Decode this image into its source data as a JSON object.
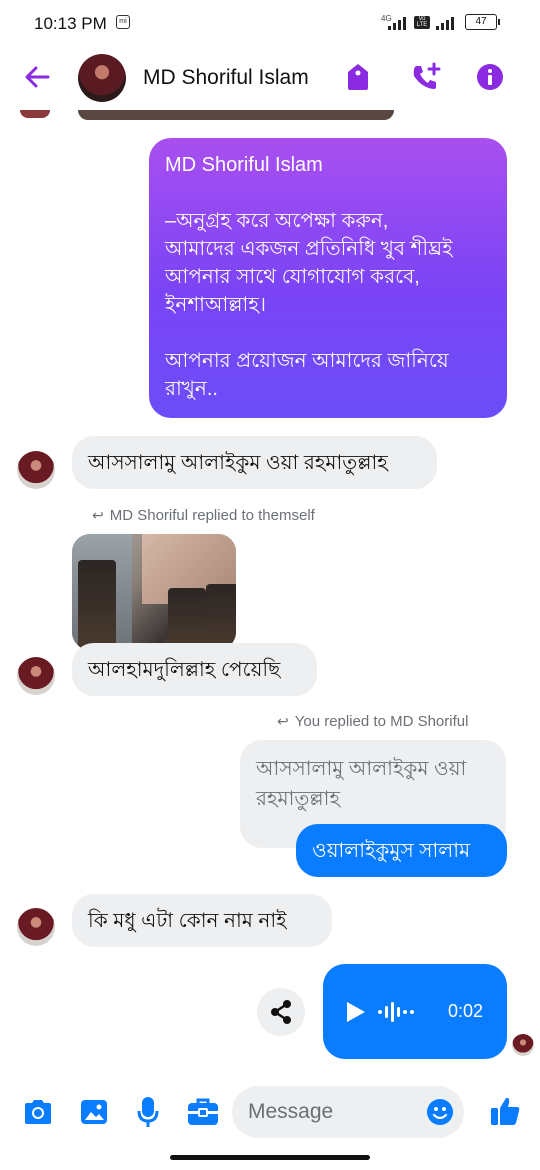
{
  "status_bar": {
    "time": "10:13 PM",
    "mi_label": "mi",
    "network": "4G",
    "volte": "Vo LTE",
    "battery": "47"
  },
  "header": {
    "contact_name": "MD Shoriful Islam",
    "accent_color": "#8a2be2",
    "icons": [
      "back-arrow-icon",
      "tag-icon",
      "add-call-icon",
      "info-icon"
    ]
  },
  "messages": {
    "auto_reply": {
      "title": "MD Shoriful Islam",
      "line1": "–অনুগ্রহ করে অপেক্ষা করুন,",
      "line2": "আমাদের একজন প্রতিনিধি খুব শীঘ্রই",
      "line3": "আপনার সাথে যোগাযোগ করবে,",
      "line4": "ইনশাআল্লাহ।",
      "line5": "আপনার প্রয়োজন আমাদের জানিয়ে",
      "line6": "রাখুন.."
    },
    "greeting": "আসসালামু আলাইকুম ওয়া রহমাতুল্লাহ",
    "reply_meta_1": "MD Shoriful replied to themself",
    "alhamdulillah": "আলহামদুলিল্লাহ পেয়েছি",
    "reply_meta_2": "You replied to MD Shoriful",
    "quoted_line1": "আসসালামু আলাইকুম ওয়া",
    "quoted_line2": "রহমাতুল্লাহ",
    "my_reply": "ওয়ালাইকুমুস সালাম",
    "question": "কি মধু  এটা কোন নাম নাই",
    "voice_duration": "0:02"
  },
  "composer": {
    "placeholder": "Message",
    "icons": [
      "camera-icon",
      "gallery-icon",
      "microphone-icon",
      "briefcase-icon",
      "emoji-icon",
      "like-icon"
    ]
  },
  "colors": {
    "sent_blue": "#0a7cff",
    "gradient_top": "#a94ff0",
    "gradient_bottom": "#6b4df7",
    "received_gray": "#eeeff1"
  }
}
